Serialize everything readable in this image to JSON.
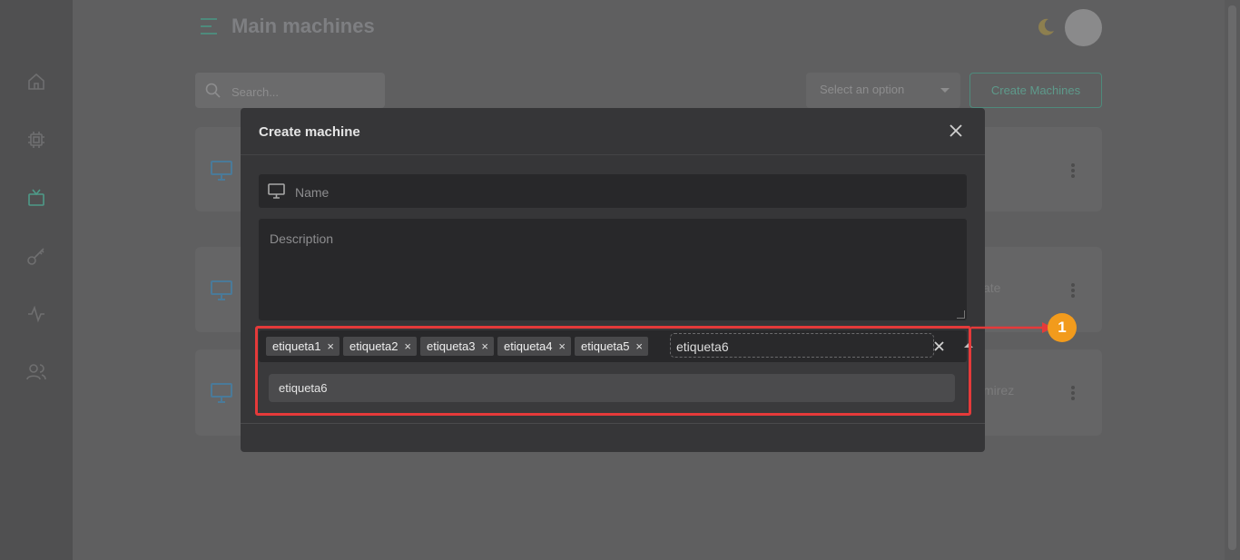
{
  "header": {
    "title": "Main machines"
  },
  "toolbar": {
    "search_placeholder": "Search...",
    "select_placeholder": "Select an option",
    "create_label": "Create Machines"
  },
  "cards": {
    "partial_texts": [
      "ate",
      "mirez"
    ]
  },
  "modal": {
    "title": "Create machine",
    "name_placeholder": "Name",
    "description_placeholder": "Description",
    "tags": [
      {
        "label": "etiqueta1",
        "remove": "×"
      },
      {
        "label": "etiqueta2",
        "remove": "×"
      },
      {
        "label": "etiqueta3",
        "remove": "×"
      },
      {
        "label": "etiqueta4",
        "remove": "×"
      },
      {
        "label": "etiqueta5",
        "remove": "×"
      }
    ],
    "tag_input_value": "etiqueta6",
    "dropdown_option": "etiqueta6"
  },
  "annotation": {
    "callout_number": "1",
    "highlight_color": "#e53a3a",
    "callout_color": "#f29b1c"
  },
  "colors": {
    "accent": "#4e9a88",
    "overlay_background": "#5f5f60",
    "modal_background": "#363638"
  }
}
